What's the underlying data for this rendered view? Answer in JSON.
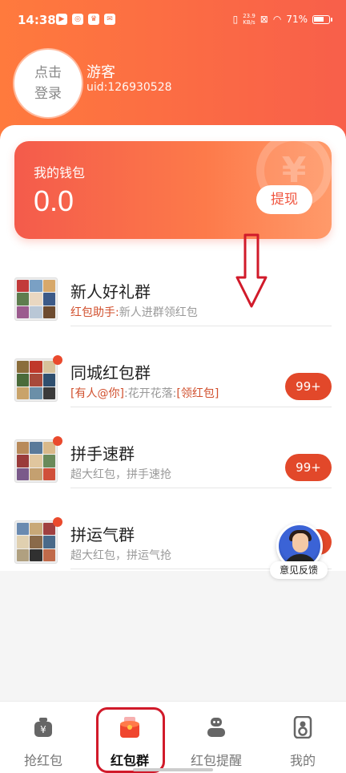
{
  "status_bar": {
    "time": "14:38",
    "net_speed_value": "23.9",
    "net_speed_unit": "KB/s",
    "battery_percent": "71%"
  },
  "profile": {
    "avatar_text_line1": "点击",
    "avatar_text_line2": "登录",
    "username": "游客",
    "uid": "uid:126930528"
  },
  "wallet": {
    "title": "我的钱包",
    "amount": "0.0",
    "withdraw_label": "提现",
    "coin_symbol": "¥"
  },
  "groups": [
    {
      "name": "新人好礼群",
      "sub_highlight": "红包助手:",
      "sub_text": "新人进群领红包",
      "badge": "",
      "dot": false
    },
    {
      "name": "同城红包群",
      "sub_highlight": "[有人@你]",
      "sub_text": ":花开花落:",
      "sub_highlight2": "[领红包]",
      "badge": "99+",
      "dot": true
    },
    {
      "name": "拼手速群",
      "sub_highlight": "",
      "sub_text": "超大红包，拼手速抢",
      "badge": "99+",
      "dot": true
    },
    {
      "name": "拼运气群",
      "sub_highlight": "",
      "sub_text": "超大红包，拼运气抢",
      "badge": "",
      "dot": true
    }
  ],
  "feedback": {
    "label": "意见反馈"
  },
  "tabs": [
    {
      "label": "抢红包",
      "icon": "money-bag-icon"
    },
    {
      "label": "红包群",
      "icon": "red-envelope-group-icon"
    },
    {
      "label": "红包提醒",
      "icon": "robot-icon"
    },
    {
      "label": "我的",
      "icon": "profile-icon"
    }
  ],
  "colors": {
    "header_start": "#ff7a3d",
    "header_end": "#f85f4a",
    "accent_red": "#e2482a",
    "annotation_red": "#d11a2a"
  }
}
